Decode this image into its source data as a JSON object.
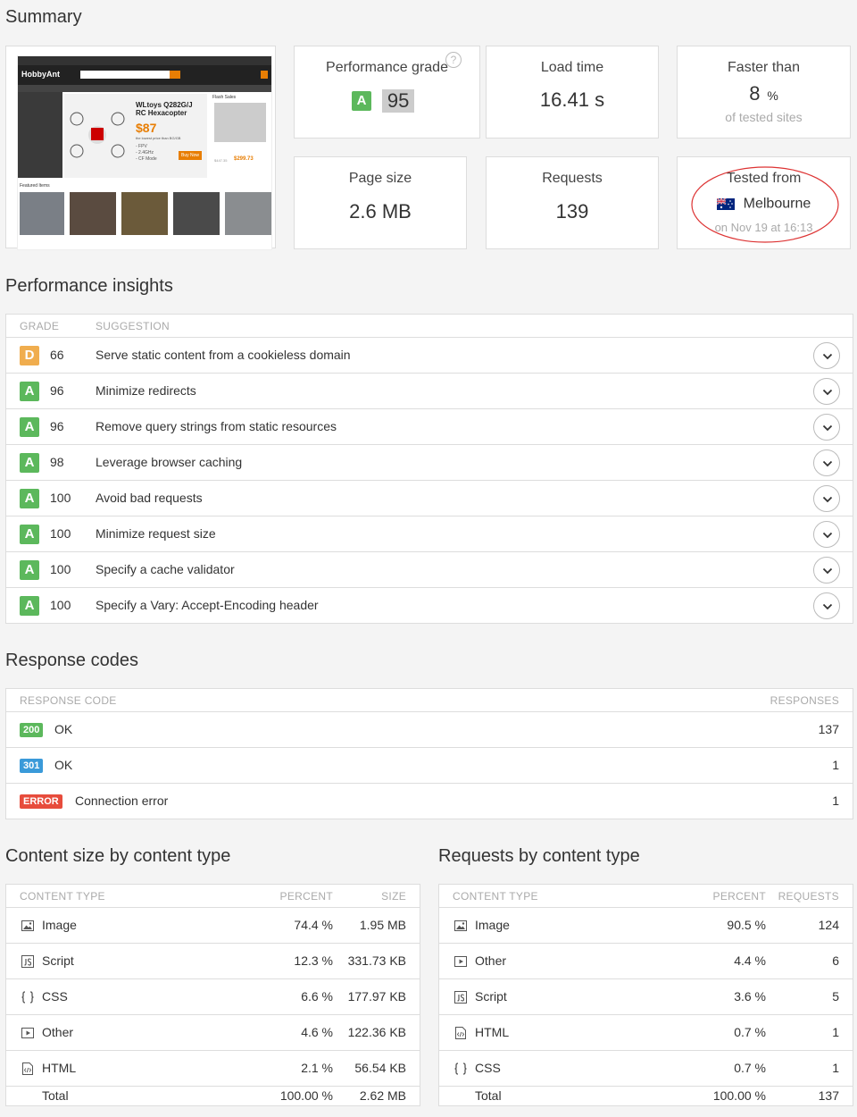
{
  "summary": {
    "title": "Summary",
    "thumbnail": {
      "logo": "HobbyAnt",
      "promo_title": "WLtoys Q282G/J RC Hexacopter",
      "promo_price": "$87",
      "promo_note": "the lowest price than BG/GB",
      "promo_specs": [
        "- FPV",
        "- 2.4GHz",
        "- CF Mode"
      ],
      "buy_now": "Buy Now",
      "flash_sales": "Flash Sales",
      "flash_price": "$299.73",
      "flash_old": "$447.35",
      "featured": "Featured Items"
    },
    "performance_grade": {
      "label": "Performance grade",
      "letter": "A",
      "score": "95",
      "help_icon": "question-circle-icon"
    },
    "load_time": {
      "label": "Load time",
      "value": "16.41 s"
    },
    "faster_than": {
      "label": "Faster than",
      "value": "8",
      "unit": "%",
      "sub": "of tested sites"
    },
    "page_size": {
      "label": "Page size",
      "value": "2.6 MB"
    },
    "requests": {
      "label": "Requests",
      "value": "139"
    },
    "tested_from": {
      "label": "Tested from",
      "location": "Melbourne",
      "flag": "australia-flag-icon",
      "date": "on Nov 19 at 16:13"
    }
  },
  "insights": {
    "title": "Performance insights",
    "col_grade": "GRADE",
    "col_suggestion": "SUGGESTION",
    "rows": [
      {
        "grade": "D",
        "score": "66",
        "text": "Serve static content from a cookieless domain"
      },
      {
        "grade": "A",
        "score": "96",
        "text": "Minimize redirects"
      },
      {
        "grade": "A",
        "score": "96",
        "text": "Remove query strings from static resources"
      },
      {
        "grade": "A",
        "score": "98",
        "text": "Leverage browser caching"
      },
      {
        "grade": "A",
        "score": "100",
        "text": "Avoid bad requests"
      },
      {
        "grade": "A",
        "score": "100",
        "text": "Minimize request size"
      },
      {
        "grade": "A",
        "score": "100",
        "text": "Specify a cache validator"
      },
      {
        "grade": "A",
        "score": "100",
        "text": "Specify a Vary: Accept-Encoding header"
      }
    ]
  },
  "response_codes": {
    "title": "Response codes",
    "col_code": "RESPONSE CODE",
    "col_responses": "RESPONSES",
    "rows": [
      {
        "code": "200",
        "text": "OK",
        "count": "137",
        "color": "#5cb85c"
      },
      {
        "code": "301",
        "text": "OK",
        "count": "1",
        "color": "#3a9ad9"
      },
      {
        "code": "ERROR",
        "text": "Connection error",
        "count": "1",
        "color": "#e74c3c"
      }
    ]
  },
  "content_size": {
    "title": "Content size by content type",
    "col_type": "CONTENT TYPE",
    "col_percent": "PERCENT",
    "col_size": "SIZE",
    "rows": [
      {
        "icon": "image-icon",
        "type": "Image",
        "percent": "74.4 %",
        "size": "1.95 MB"
      },
      {
        "icon": "script-icon",
        "type": "Script",
        "percent": "12.3 %",
        "size": "331.73 KB"
      },
      {
        "icon": "css-icon",
        "type": "CSS",
        "percent": "6.6 %",
        "size": "177.97 KB"
      },
      {
        "icon": "other-icon",
        "type": "Other",
        "percent": "4.6 %",
        "size": "122.36 KB"
      },
      {
        "icon": "html-icon",
        "type": "HTML",
        "percent": "2.1 %",
        "size": "56.54 KB"
      }
    ],
    "total": {
      "label": "Total",
      "percent": "100.00 %",
      "size": "2.62 MB"
    }
  },
  "requests_by_type": {
    "title": "Requests by content type",
    "col_type": "CONTENT TYPE",
    "col_percent": "PERCENT",
    "col_requests": "REQUESTS",
    "rows": [
      {
        "icon": "image-icon",
        "type": "Image",
        "percent": "90.5 %",
        "requests": "124"
      },
      {
        "icon": "other-icon",
        "type": "Other",
        "percent": "4.4 %",
        "requests": "6"
      },
      {
        "icon": "script-icon",
        "type": "Script",
        "percent": "3.6 %",
        "requests": "5"
      },
      {
        "icon": "html-icon",
        "type": "HTML",
        "percent": "0.7 %",
        "requests": "1"
      },
      {
        "icon": "css-icon",
        "type": "CSS",
        "percent": "0.7 %",
        "requests": "1"
      }
    ],
    "total": {
      "label": "Total",
      "percent": "100.00 %",
      "requests": "137"
    }
  }
}
